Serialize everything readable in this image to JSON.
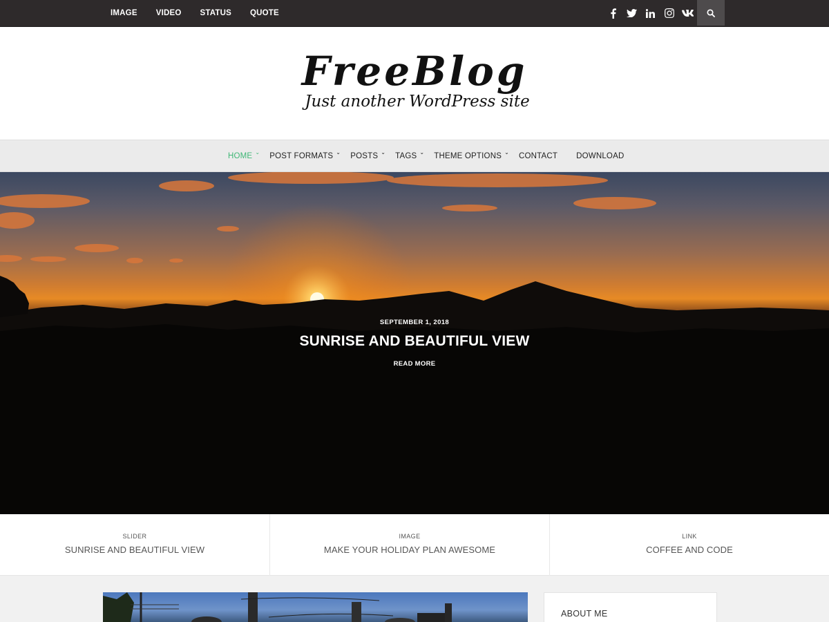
{
  "topbar": {
    "nav": [
      "IMAGE",
      "VIDEO",
      "STATUS",
      "QUOTE"
    ],
    "social_icons": [
      "facebook-icon",
      "twitter-icon",
      "linkedin-icon",
      "instagram-icon",
      "vk-icon"
    ],
    "search_icon": "search-icon"
  },
  "header": {
    "site_title": "FreeBlog",
    "tagline": "Just another WordPress site"
  },
  "main_nav": [
    {
      "label": "HOME",
      "dropdown": true,
      "active": true
    },
    {
      "label": "POST FORMATS",
      "dropdown": true,
      "active": false
    },
    {
      "label": "POSTS",
      "dropdown": true,
      "active": false
    },
    {
      "label": "TAGS",
      "dropdown": true,
      "active": false
    },
    {
      "label": "THEME OPTIONS",
      "dropdown": true,
      "active": false
    },
    {
      "label": "CONTACT",
      "dropdown": false,
      "active": false
    },
    {
      "label": "DOWNLOAD",
      "dropdown": false,
      "active": false
    }
  ],
  "hero": {
    "date": "SEPTEMBER 1, 2018",
    "title": "SUNRISE AND BEAUTIFUL VIEW",
    "read_more": "READ MORE"
  },
  "featured": [
    {
      "category": "SLIDER",
      "title": "SUNRISE AND BEAUTIFUL VIEW"
    },
    {
      "category": "IMAGE",
      "title": "MAKE YOUR HOLIDAY PLAN AWESOME"
    },
    {
      "category": "LINK",
      "title": "COFFEE AND CODE"
    }
  ],
  "sidebar": {
    "widget_title": "ABOUT ME"
  },
  "colors": {
    "topbar_bg": "#2e2a2b",
    "accent": "#3fb776",
    "nav_bg": "#ebebeb"
  }
}
